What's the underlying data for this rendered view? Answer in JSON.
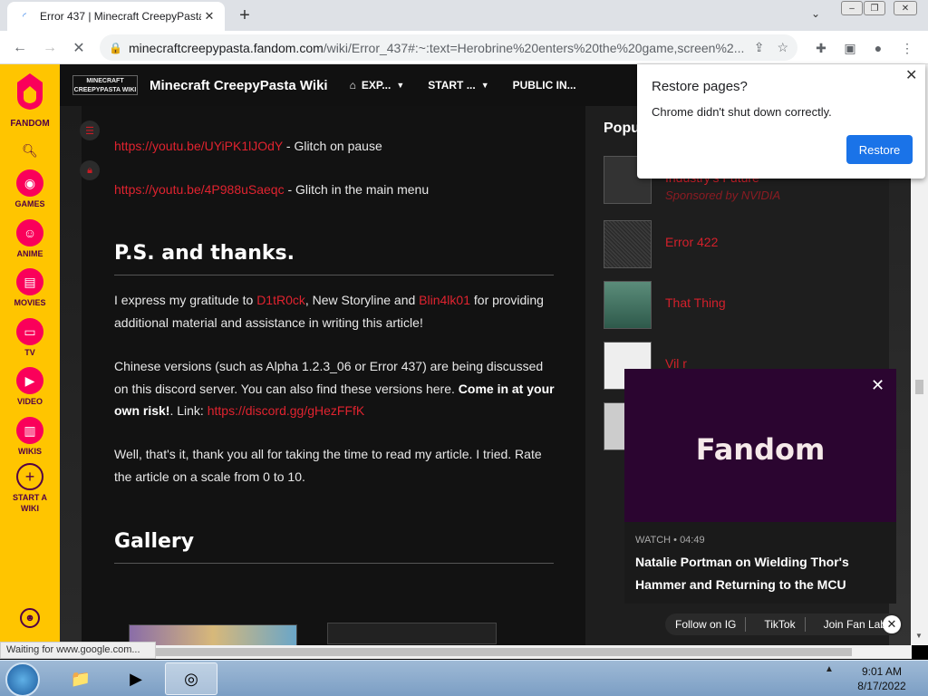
{
  "browser": {
    "tab_title": "Error 437 | Minecraft CreepyPasta Wiki",
    "url_host": "minecraftcreepypasta.fandom.com",
    "url_path": "/wiki/Error_437#:~:text=Herobrine%20enters%20the%20game,screen%2...",
    "status_text": "Waiting for www.google.com..."
  },
  "fandom_rail": {
    "logo_text": "FANDOM",
    "items": [
      {
        "label": "GAMES",
        "icon": "gamepad-icon"
      },
      {
        "label": "ANIME",
        "icon": "anime-icon"
      },
      {
        "label": "MOVIES",
        "icon": "movie-icon"
      },
      {
        "label": "TV",
        "icon": "tv-icon"
      },
      {
        "label": "VIDEO",
        "icon": "video-icon"
      },
      {
        "label": "WIKIS",
        "icon": "wikis-icon"
      },
      {
        "label": "START A",
        "label2": "WIKI",
        "icon": "plus-icon"
      }
    ]
  },
  "wiki": {
    "logo_line1": "MINECRAFT",
    "logo_line2": "CREEPYPASTA WIKI",
    "name": "Minecraft CreepyPasta Wiki",
    "nav": [
      "EXP...",
      "START ...",
      "PUBLIC IN..."
    ]
  },
  "article": {
    "link1": "https://youtu.be/UYiPK1lJOdY",
    "link1_desc": " - Glitch on pause",
    "link2": "https://youtu.be/4P988uSaeqc",
    "link2_desc": " - Glitch in the main menu",
    "heading_ps": "P.S. and thanks.",
    "thanks_1": "I express my gratitude to ",
    "thanks_user1": "D1tR0ck",
    "thanks_2": ", New Storyline and ",
    "thanks_user2": "Blin4lk01",
    "thanks_3": " for providing additional material and assistance in writing this article!",
    "chinese_1": "Chinese versions (such as Alpha 1.2.3_06 or Error 437) are being discussed on this discord server. You can also find these versions here. ",
    "chinese_bold": "Come in at your own risk!",
    "chinese_2": ". Link: ",
    "discord_link": "https://discord.gg/gHezFFfK",
    "closing": "Well, that's it, thank you all for taking the time to read my article. I tried. Rate the article on a scale from 0 to 10.",
    "heading_gallery": "Gallery"
  },
  "popular": {
    "title": "Popu",
    "items": [
      {
        "title": "Industry's Future",
        "sub": "Sponsored by NVIDIA"
      },
      {
        "title": "Error 422",
        "sub": ""
      },
      {
        "title": "That Thing",
        "sub": ""
      },
      {
        "title": "Vil r",
        "sub": ""
      }
    ]
  },
  "restore_dialog": {
    "title": "Restore pages?",
    "message": "Chrome didn't shut down correctly.",
    "button": "Restore"
  },
  "video": {
    "brand": "Fandom",
    "meta": "WATCH • 04:49",
    "title": "Natalie Portman on Wielding Thor's Hammer and Returning to the MCU"
  },
  "social": [
    "Follow on IG",
    "TikTok",
    "Join Fan Lab"
  ],
  "taskbar": {
    "time": "9:01 AM",
    "date": "8/17/2022"
  },
  "colors": {
    "fandom_yellow": "#ffc500",
    "link_red": "#e0232f",
    "restore_blue": "#1a73e8"
  }
}
